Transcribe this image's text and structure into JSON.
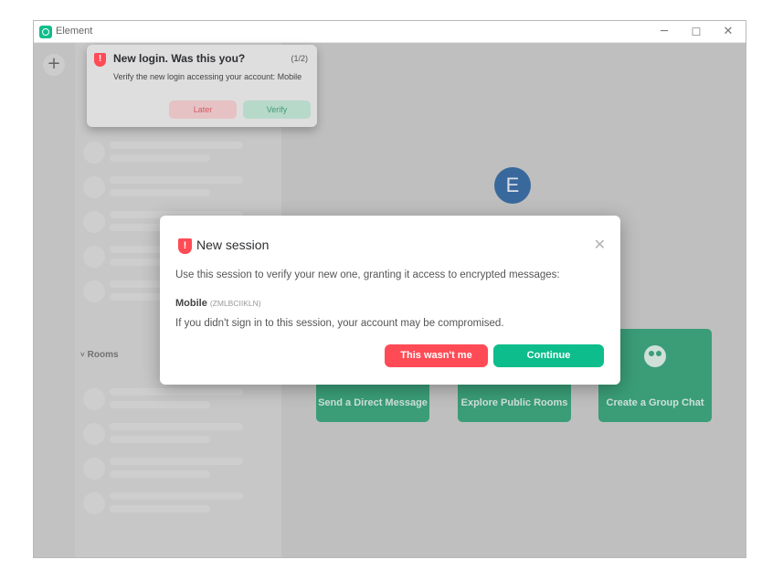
{
  "window": {
    "title": "Element",
    "controls": {
      "minimize": "─",
      "maximize": "☐",
      "close": "✕"
    }
  },
  "spaces": {
    "add_label": "+"
  },
  "sidebar": {
    "rooms_header": "Rooms"
  },
  "main": {
    "avatar_letter": "E",
    "tiles": [
      {
        "label": "Send a Direct Message",
        "icon": "chat-icon"
      },
      {
        "label": "Explore Public Rooms",
        "icon": "explore-icon"
      },
      {
        "label": "Create a Group Chat",
        "icon": "group-icon"
      }
    ]
  },
  "toast": {
    "title": "New login. Was this you?",
    "count": "(1/2)",
    "description": "Verify the new login accessing your account: Mobile",
    "later_label": "Later",
    "verify_label": "Verify"
  },
  "dialog": {
    "title": "New session",
    "description": "Use this session to verify your new one, granting it access to encrypted messages:",
    "session_name": "Mobile",
    "session_id": "(ZMLBCIIKLN)",
    "warning": "If you didn't sign in to this session, your account may be compromised.",
    "reject_label": "This wasn't me",
    "continue_label": "Continue",
    "close_glyph": "✕"
  },
  "colors": {
    "accent": "#0dbd8b",
    "danger": "#ff4b55",
    "avatar": "#3a6ea5"
  }
}
